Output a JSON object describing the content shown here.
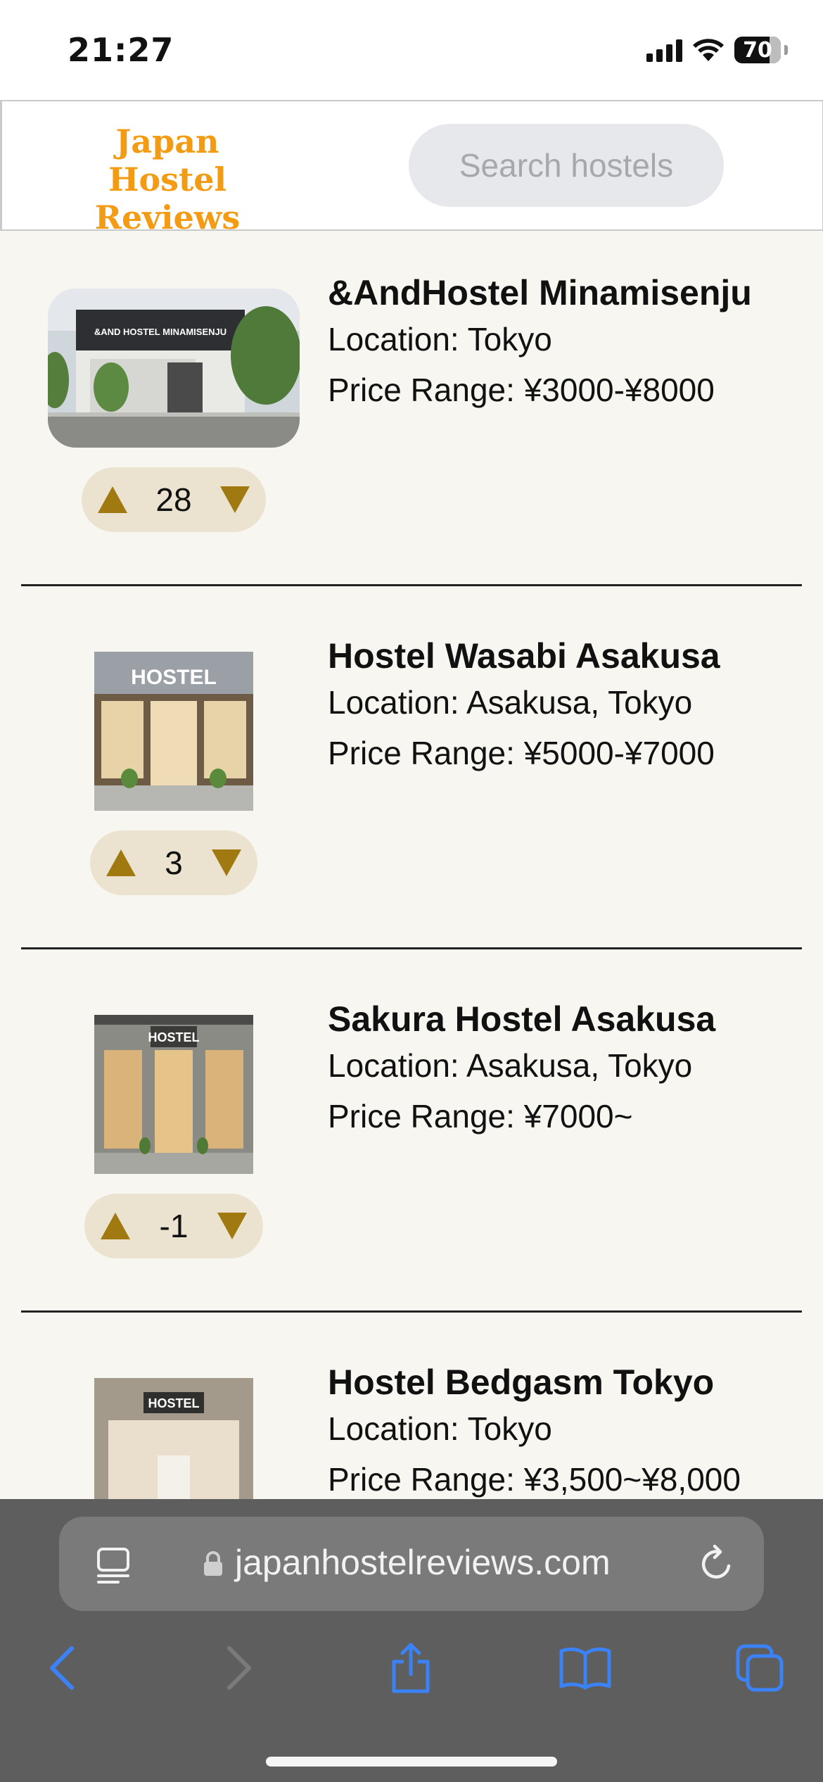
{
  "status_bar": {
    "time": "21:27",
    "battery": "70"
  },
  "header": {
    "logo_line1": "Japan",
    "logo_line2": "Hostel Reviews",
    "search_placeholder": "Search hostels"
  },
  "listings": [
    {
      "name": "&AndHostel Minamisenju",
      "location": "Location: Tokyo",
      "price": "Price Range: ¥3000-¥8000",
      "votes": "28",
      "image_sign": "&AND HOSTEL MINAMISENJU"
    },
    {
      "name": "Hostel Wasabi Asakusa",
      "location": "Location: Asakusa, Tokyo",
      "price": "Price Range: ¥5000-¥7000",
      "votes": "3",
      "image_sign": "HOSTEL"
    },
    {
      "name": "Sakura Hostel Asakusa",
      "location": "Location: Asakusa, Tokyo",
      "price": "Price Range: ¥7000~",
      "votes": "-1",
      "image_sign": "HOSTEL"
    },
    {
      "name": "Hostel Bedgasm Tokyo",
      "location": "Location: Tokyo",
      "price": "Price Range: ¥3,500~¥8,000",
      "votes": "",
      "image_sign": "HOSTEL"
    }
  ],
  "browser": {
    "url": "japanhostelreviews.com"
  },
  "colors": {
    "accent": "#f39b12",
    "vote_arrow": "#a07a10",
    "vote_bg": "#ebe3cf",
    "browser_bar": "#5e5e5e",
    "ios_blue": "#3b82f6"
  }
}
